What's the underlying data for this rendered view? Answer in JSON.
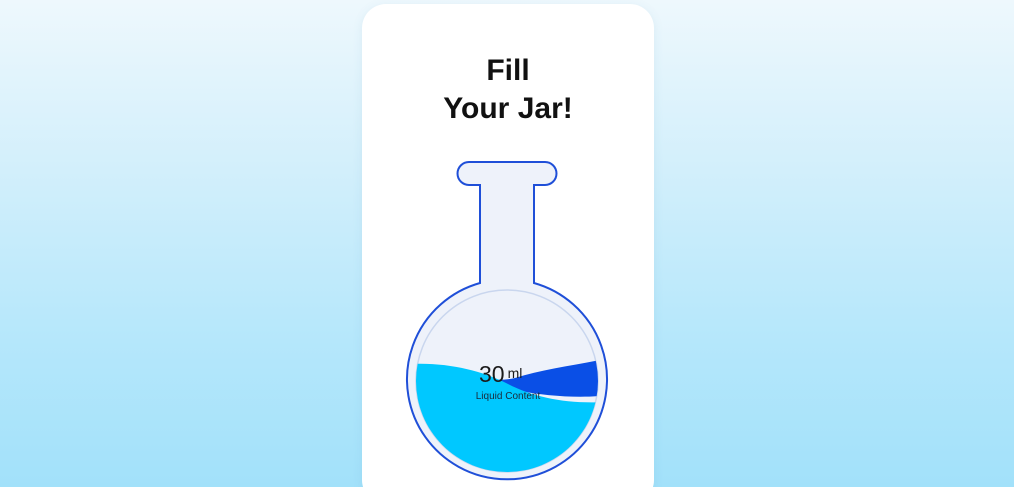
{
  "header": {
    "title_line1": "Fill",
    "title_line2": "Your Jar!"
  },
  "flask": {
    "volume_value": "30",
    "volume_unit": "ml",
    "caption": "Liquid Content",
    "colors": {
      "outline": "#1f4fd8",
      "liquid_light": "#00c8ff",
      "liquid_dark": "#0a4fe6",
      "glass_bg": "#eef2fa"
    }
  }
}
